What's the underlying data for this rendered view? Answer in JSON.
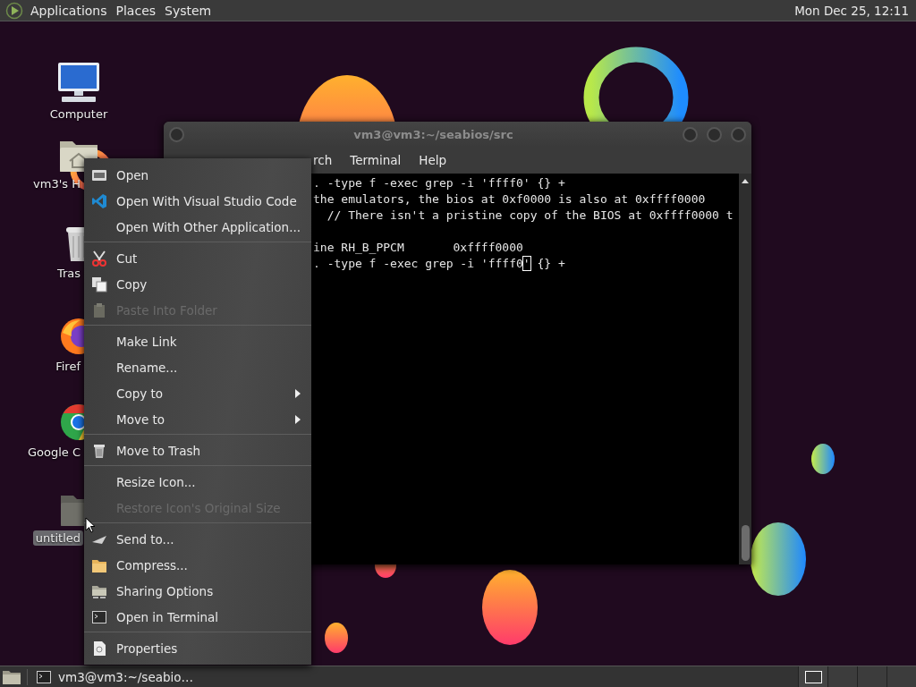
{
  "top_panel": {
    "menus": [
      "Applications",
      "Places",
      "System"
    ],
    "clock": "Mon Dec 25, 12:11"
  },
  "desktop_icons": [
    {
      "kind": "computer",
      "label": "Computer",
      "selected": false
    },
    {
      "kind": "home",
      "label": "vm3's H",
      "selected": false
    },
    {
      "kind": "trash",
      "label": "Tras",
      "selected": false
    },
    {
      "kind": "firefox",
      "label": "Firef",
      "selected": false
    },
    {
      "kind": "chrome",
      "label": "Google C",
      "selected": false
    },
    {
      "kind": "folder",
      "label": "untitled",
      "selected": true
    }
  ],
  "terminal": {
    "title": "vm3@vm3:~/seabios/src",
    "menus": [
      "rch",
      "Terminal",
      "Help"
    ],
    "lines": [
      {
        "kind": "text",
        "text": ". -type f -exec grep -i 'ffff0' {} +"
      },
      {
        "kind": "text",
        "text": "the emulators, the bios at 0xf0000 is also at 0xffff0000"
      },
      {
        "kind": "text",
        "text": "  // There isn't a pristine copy of the BIOS at 0xffff0000 t"
      },
      {
        "kind": "blank"
      },
      {
        "kind": "text",
        "text": "ine RH_B_PPCM       0xffff0000"
      },
      {
        "kind": "text",
        "text": ". -type f -exec grep -i 'ffff0",
        "cursor": "'",
        "after": " {} +"
      }
    ]
  },
  "context_menu": {
    "sections": [
      [
        {
          "label": "Open",
          "disabled": false,
          "submenu": false
        },
        {
          "label": "Open With Visual Studio Code",
          "disabled": false,
          "submenu": false
        },
        {
          "label": "Open With Other Application...",
          "disabled": false,
          "submenu": false
        }
      ],
      [
        {
          "label": "Cut",
          "disabled": false,
          "submenu": false
        },
        {
          "label": "Copy",
          "disabled": false,
          "submenu": false
        },
        {
          "label": "Paste Into Folder",
          "disabled": true,
          "submenu": false
        }
      ],
      [
        {
          "label": "Make Link",
          "disabled": false,
          "submenu": false
        },
        {
          "label": "Rename...",
          "disabled": false,
          "submenu": false
        },
        {
          "label": "Copy to",
          "disabled": false,
          "submenu": true
        },
        {
          "label": "Move to",
          "disabled": false,
          "submenu": true
        }
      ],
      [
        {
          "label": "Move to Trash",
          "disabled": false,
          "submenu": false
        }
      ],
      [
        {
          "label": "Resize Icon...",
          "disabled": false,
          "submenu": false
        },
        {
          "label": "Restore Icon's Original Size",
          "disabled": true,
          "submenu": false
        }
      ],
      [
        {
          "label": "Send to...",
          "disabled": false,
          "submenu": false
        },
        {
          "label": "Compress...",
          "disabled": false,
          "submenu": false
        },
        {
          "label": "Sharing Options",
          "disabled": false,
          "submenu": false
        },
        {
          "label": "Open in Terminal",
          "disabled": false,
          "submenu": false
        }
      ],
      [
        {
          "label": "Properties",
          "disabled": false,
          "submenu": false
        }
      ]
    ]
  },
  "bottom_panel": {
    "tasks": [
      {
        "label": "vm3@vm3:~/seabio…",
        "selected": false
      }
    ],
    "workspaces": [
      {
        "selected": true
      },
      {
        "selected": false
      },
      {
        "selected": false
      },
      {
        "selected": false
      }
    ]
  }
}
